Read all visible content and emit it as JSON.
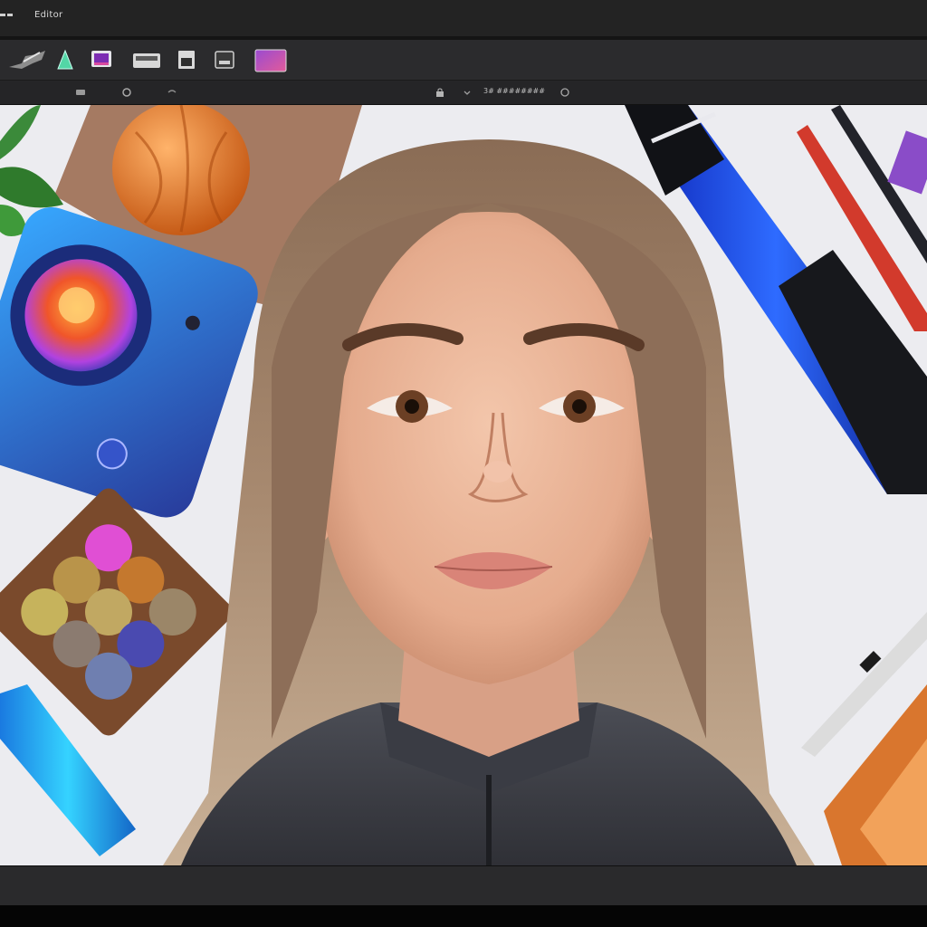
{
  "window": {
    "title": "Editor"
  },
  "toolbar": {
    "tools": [
      {
        "name": "brush-tool-icon"
      },
      {
        "name": "shape-tool-icon"
      },
      {
        "name": "image-tool-icon"
      },
      {
        "name": "layer-tool-icon"
      },
      {
        "name": "document-tool-icon"
      },
      {
        "name": "export-tool-icon"
      },
      {
        "name": "gallery-tool-icon"
      }
    ]
  },
  "options_bar": {
    "zoom_label": "3# ########"
  },
  "colors": {
    "titlebar": "#232323",
    "toolbar": "#2b2b2d",
    "canvas_bg": "#ededf1",
    "accent_blue": "#1f5cff"
  }
}
